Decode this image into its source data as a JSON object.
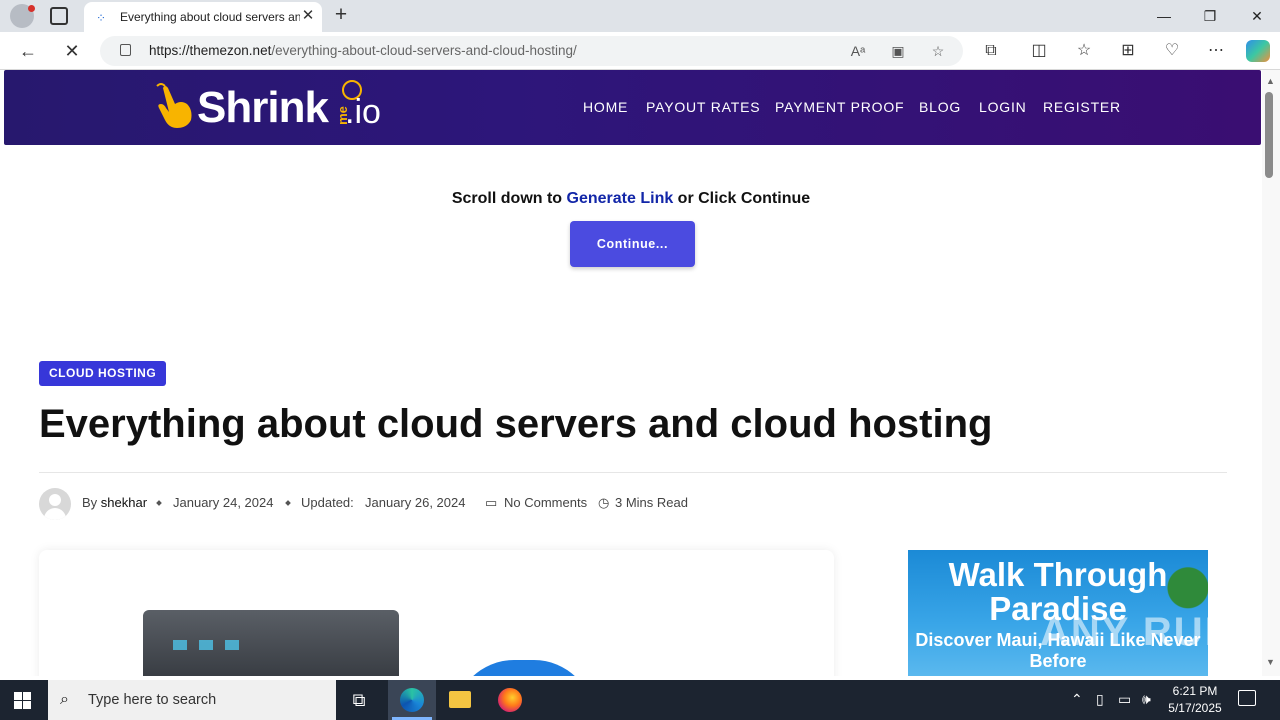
{
  "browser": {
    "tab_title": "Everything about cloud servers and cloud hosting",
    "tab_close": "✕",
    "new_tab": "+",
    "url_domain": "https://themezon.net",
    "url_path": "/everything-about-cloud-servers-and-cloud-hosting/",
    "window_controls": {
      "minimize": "—",
      "restore": "❐",
      "close": "✕"
    },
    "nav": {
      "back": "←",
      "stop": "✕"
    },
    "address_icons": [
      "read-aloud-icon",
      "immersive-reader-icon",
      "favorite-star-icon"
    ],
    "toolbar_icons": [
      "extensions-icon",
      "split-screen-icon",
      "favorites-icon",
      "collections-icon",
      "browser-essentials-icon",
      "more-menu-icon",
      "copilot-icon"
    ]
  },
  "site": {
    "logo_word": "Shrink",
    "logo_me": "me",
    "logo_io": ".io",
    "nav": [
      "HOME",
      "PAYOUT RATES",
      "PAYMENT PROOF",
      "BLOG",
      "LOGIN",
      "REGISTER"
    ]
  },
  "notice": {
    "prefix": "Scroll down to ",
    "link": "Generate Link",
    "suffix": " or Click Continue",
    "button": "Continue..."
  },
  "article": {
    "category": "CLOUD HOSTING",
    "title": "Everything about cloud servers and cloud hosting",
    "by": "By",
    "author": "shekhar",
    "published": "January 24, 2024",
    "updated_label": "Updated:",
    "updated": "January 26, 2024",
    "comments": "No Comments",
    "read_time": "3 Mins Read"
  },
  "ad": {
    "title": "Walk Through Paradise",
    "subtitle": "Discover Maui, Hawaii Like Never Before"
  },
  "watermark": "ANY RUN",
  "taskbar": {
    "search_placeholder": "Type here to search",
    "time": "6:21 PM",
    "date": "5/17/2025"
  }
}
